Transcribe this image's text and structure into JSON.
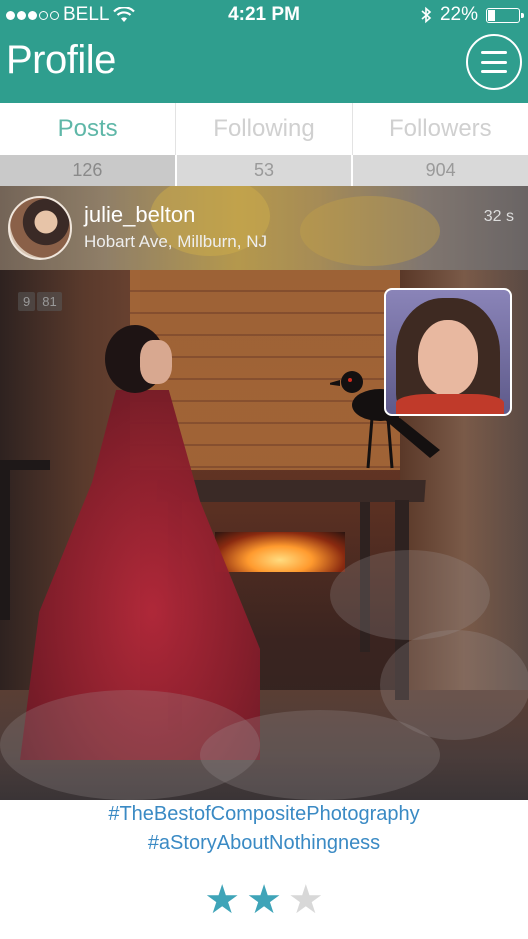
{
  "status_bar": {
    "carrier": "BELL",
    "time": "4:21 PM",
    "battery": "22%",
    "battery_level": 0.22
  },
  "nav": {
    "title": "Profile",
    "menu_icon": "hamburger-menu-icon"
  },
  "tabs": [
    {
      "label": "Posts",
      "count": "126",
      "active": true
    },
    {
      "label": "Following",
      "count": "53",
      "active": false
    },
    {
      "label": "Followers",
      "count": "904",
      "active": false
    }
  ],
  "post": {
    "username": "julie_belton",
    "location": "Hobart Ave, Millburn, NJ",
    "age": "32 s",
    "image_counter": [
      "9",
      "81"
    ],
    "hashtags": [
      "#TheBestofCompositePhotography",
      "#aStoryAboutNothingness"
    ],
    "rating": 2,
    "rating_max": 3
  },
  "colors": {
    "accent": "#2f9e8e",
    "tag": "#3a8ac4",
    "star_on": "#3fa4b8",
    "star_off": "#d8d8d8"
  }
}
